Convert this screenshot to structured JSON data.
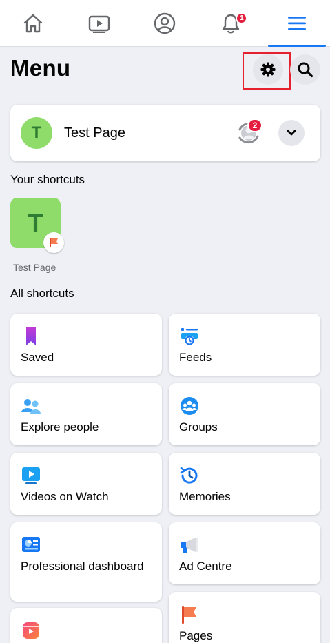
{
  "nav": {
    "notifications_badge": "1"
  },
  "header": {
    "title": "Menu"
  },
  "profile": {
    "avatar_initial": "T",
    "name": "Test Page",
    "switch_badge": "2"
  },
  "your_shortcuts": {
    "heading": "Your shortcuts",
    "items": [
      {
        "initial": "T",
        "label": "Test Page"
      }
    ]
  },
  "all_shortcuts": {
    "heading": "All shortcuts",
    "left": [
      {
        "label": "Saved",
        "icon": "bookmark-icon"
      },
      {
        "label": "Explore people",
        "icon": "people-icon"
      },
      {
        "label": "Videos on Watch",
        "icon": "watch-icon"
      },
      {
        "label": "Professional dashboard",
        "icon": "dashboard-icon"
      },
      {
        "label": "",
        "icon": "reels-icon"
      }
    ],
    "right": [
      {
        "label": "Feeds",
        "icon": "feeds-icon"
      },
      {
        "label": "Groups",
        "icon": "groups-icon"
      },
      {
        "label": "Memories",
        "icon": "memories-icon"
      },
      {
        "label": "Ad Centre",
        "icon": "megaphone-icon"
      },
      {
        "label": "Pages",
        "icon": "flag-icon"
      }
    ]
  },
  "colors": {
    "accent": "#1877f2",
    "badge": "#e41e3f",
    "avatar_green": "#8fdc6a",
    "highlight": "#e4212c"
  }
}
